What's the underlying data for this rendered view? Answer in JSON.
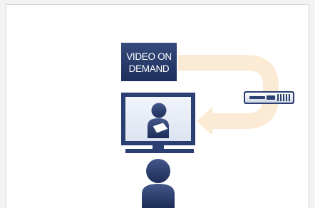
{
  "vod_box": {
    "line1": "VIDEO ON",
    "line2": "DEMAND"
  },
  "icons": {
    "set_top_box": "set-top-box-icon",
    "monitor": "tv-monitor-icon",
    "presenter": "person-on-screen-icon",
    "viewer": "viewer-person-icon",
    "flow": "curved-arrow-icon"
  },
  "colors": {
    "box_fill": "#2a3d6d",
    "arrow": "#fcebd4",
    "monitor_body": "#2b3f72",
    "screen": "#e7ecf6",
    "person": "#2a3d6d",
    "background": "#ffffff",
    "frame_border": "#d2d2d2"
  }
}
